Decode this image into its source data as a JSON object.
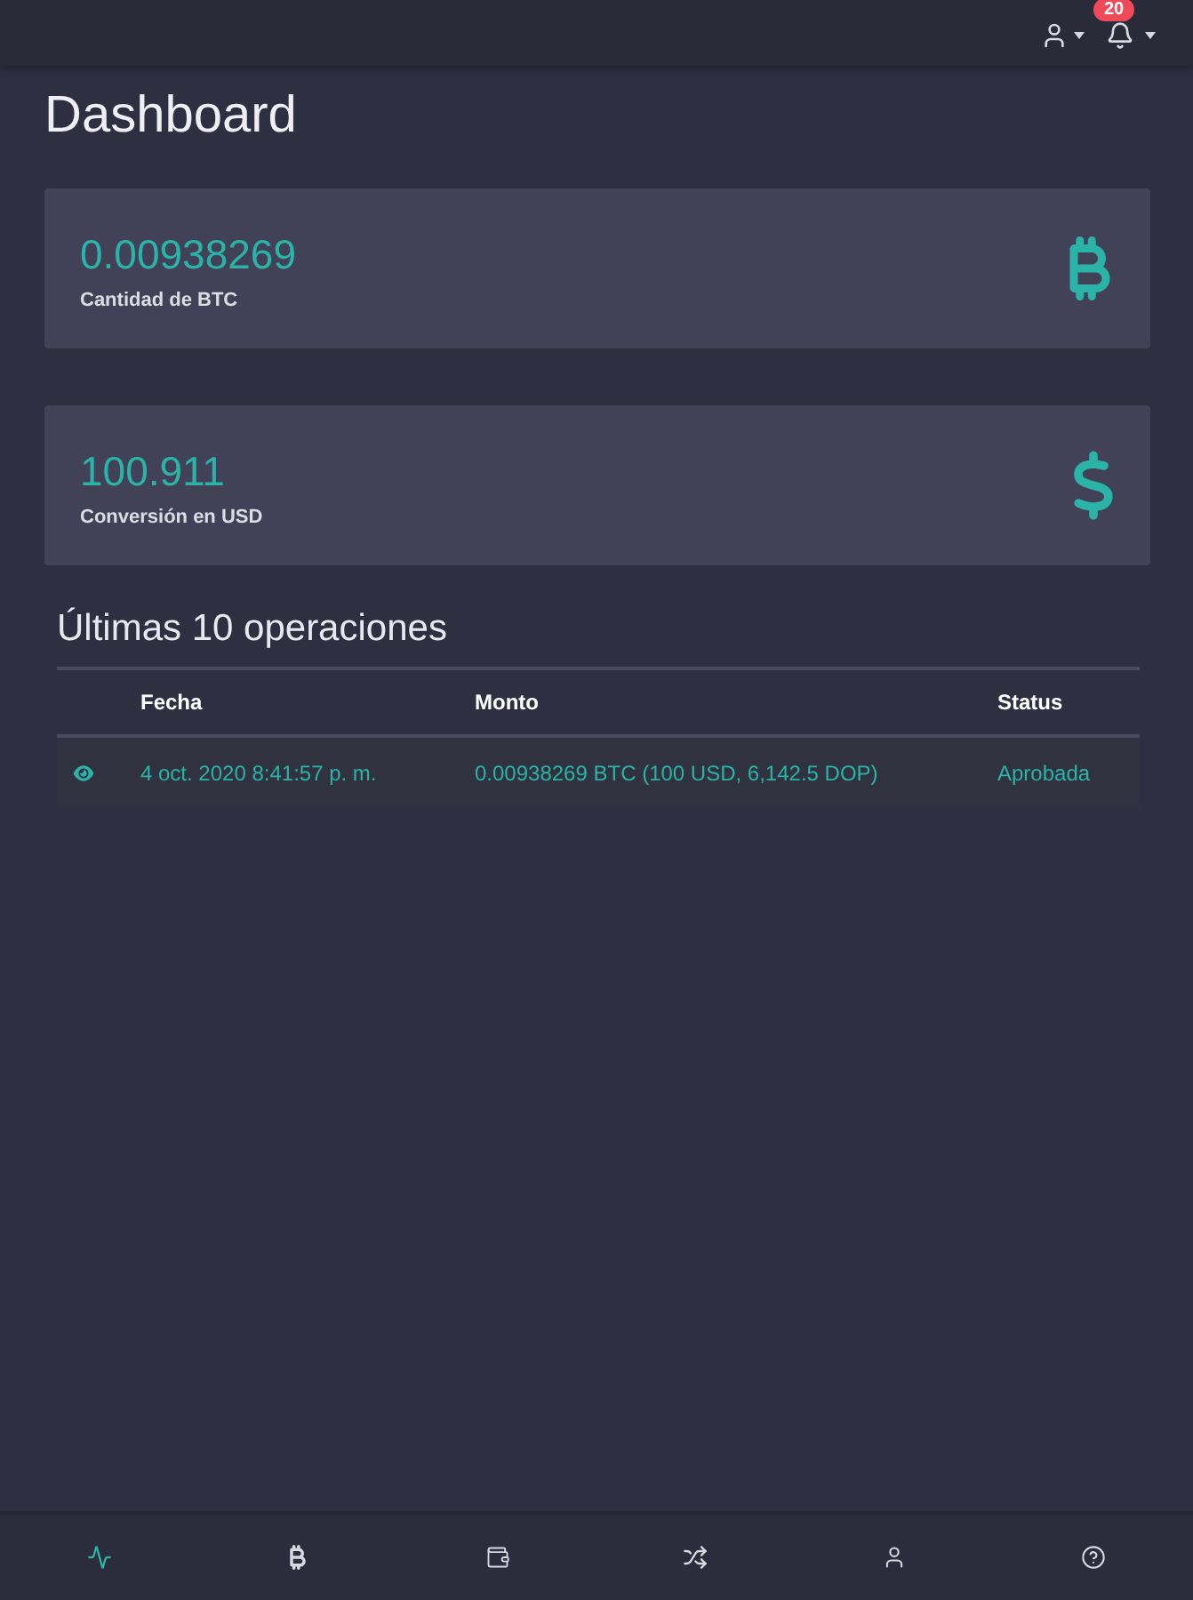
{
  "topbar": {
    "notification_count": "20"
  },
  "title": "Dashboard",
  "cards": [
    {
      "kind": "bitcoin",
      "value": "0.00938269",
      "label": "Cantidad de BTC"
    },
    {
      "kind": "dollar",
      "value": "100.911",
      "label": "Conversión en USD"
    }
  ],
  "operations": {
    "title": "Últimas 10 operaciones",
    "columns": [
      "Fecha",
      "Monto",
      "Status"
    ],
    "rows": [
      {
        "date": "4 oct. 2020 8:41:57 p. m.",
        "amount": "0.00938269 BTC (100 USD, 6,142.5 DOP)",
        "status": "Aprobada"
      }
    ]
  },
  "bottom_nav": [
    {
      "kind": "activity",
      "selected": true
    },
    {
      "kind": "bitcoin",
      "selected": false
    },
    {
      "kind": "wallet",
      "selected": false
    },
    {
      "kind": "shuffle",
      "selected": false
    },
    {
      "kind": "user",
      "selected": false
    },
    {
      "kind": "help",
      "selected": false
    }
  ]
}
